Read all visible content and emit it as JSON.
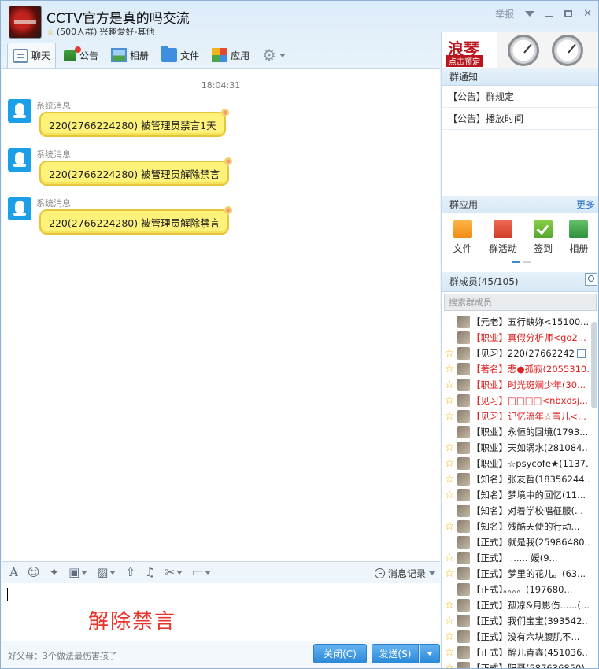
{
  "window": {
    "title": "CCTV官方是真的吗交流",
    "group_size": "(500人群)",
    "group_tag": "兴趣爱好-其他",
    "report": "举报"
  },
  "tabs": [
    {
      "label": "聊天",
      "icon": "chat-icon",
      "active": true
    },
    {
      "label": "公告",
      "icon": "notice-icon"
    },
    {
      "label": "相册",
      "icon": "photo-icon"
    },
    {
      "label": "文件",
      "icon": "file-icon"
    },
    {
      "label": "应用",
      "icon": "app-icon"
    }
  ],
  "chat": {
    "timestamp": "18:04:31",
    "messages": [
      {
        "sender": "系统消息",
        "text": "220(2766224280) 被管理员禁言1天"
      },
      {
        "sender": "系统消息",
        "text": "220(2766224280) 被管理员解除禁言"
      },
      {
        "sender": "系统消息",
        "text": "220(2766224280) 被管理员解除禁言"
      }
    ]
  },
  "input": {
    "history_label": "消息记录",
    "overlay_text": "解除禁言",
    "tip": "好父母：3个做法最伤害孩子",
    "close_label": "关闭(C)",
    "send_label": "发送(S)"
  },
  "side": {
    "banner_brand": "浪琴",
    "banner_sub": "点击预定",
    "notice_title": "群通知",
    "notices": [
      "【公告】群规定",
      "【公告】播放时间"
    ],
    "apps_title": "群应用",
    "more": "更多",
    "apps": [
      {
        "label": "文件",
        "icon": "folder-icon"
      },
      {
        "label": "群活动",
        "icon": "activity-icon"
      },
      {
        "label": "签到",
        "icon": "checkin-icon"
      },
      {
        "label": "相册",
        "icon": "album-icon"
      }
    ],
    "members_title": "群成员(45/105)",
    "search_placeholder": "搜索群成员",
    "members": [
      {
        "name": "【元老】五行缺妳<15100...",
        "red": false,
        "star": false
      },
      {
        "name": "【职业】真假分析师<go2...",
        "red": true,
        "star": false
      },
      {
        "name": "【见习】220(27662242...",
        "red": false,
        "star": true
      },
      {
        "name": "【著名】悲●孤寂(2055310...",
        "red": true,
        "star": true
      },
      {
        "name": "【职业】时光斑斓少年(30...",
        "red": true,
        "star": true
      },
      {
        "name": "【见习】□□□□<nbxdsj...",
        "red": true,
        "star": true
      },
      {
        "name": "【见习】记忆流年☆雪儿<...",
        "red": true,
        "star": true
      },
      {
        "name": "【职业】永恒的回境(1793...",
        "red": false,
        "star": false
      },
      {
        "name": "【职业】天如涡水(281084...",
        "red": false,
        "star": true
      },
      {
        "name": "【职业】☆psycofe★(1137...",
        "red": false,
        "star": true
      },
      {
        "name": "【知名】张友哲(18356244...",
        "red": false,
        "star": true
      },
      {
        "name": "【知名】梦境中的回忆(11...",
        "red": false,
        "star": true
      },
      {
        "name": "【知名】对着学校唱征服(...",
        "red": false,
        "star": false
      },
      {
        "name": "【知名】残酷天使的行动...",
        "red": false,
        "star": true
      },
      {
        "name": "【正式】就是我(25986480...",
        "red": false,
        "star": false
      },
      {
        "name": "【正式】 ......  嫒(9...",
        "red": false,
        "star": true
      },
      {
        "name": "【正式】梦里的花儿。(63...",
        "red": false,
        "star": true
      },
      {
        "name": "【正式】。。。。(197680...",
        "red": false,
        "star": false
      },
      {
        "name": "【正式】孤凉&月影伤......(...",
        "red": false,
        "star": true
      },
      {
        "name": "【正式】我们宝宝(393542...",
        "red": false,
        "star": true
      },
      {
        "name": "【正式】没有六块腹肌不...",
        "red": false,
        "star": true
      },
      {
        "name": "【正式】醉儿青鑫(451036...",
        "red": false,
        "star": true
      },
      {
        "name": "【正式】阳哥(587636850)",
        "red": false,
        "star": true
      }
    ]
  }
}
